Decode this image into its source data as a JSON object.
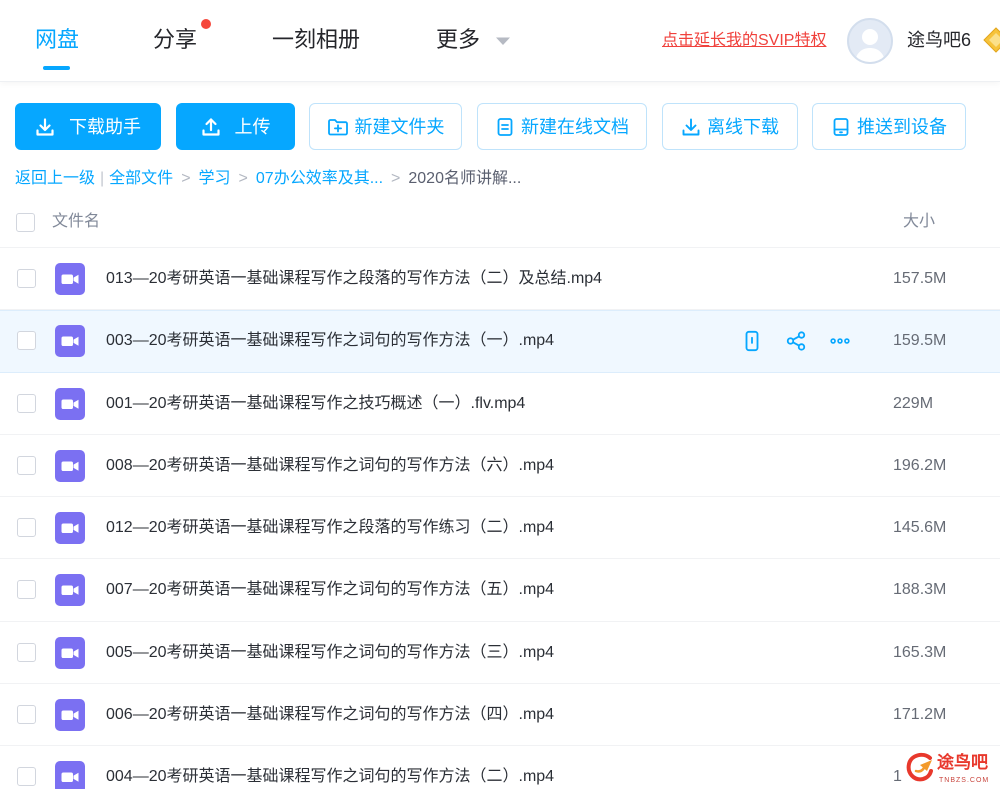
{
  "nav": {
    "tabs": [
      {
        "label": "网盘",
        "active": true
      },
      {
        "label": "分享",
        "has_notification_dot": true
      },
      {
        "label": "一刻相册"
      },
      {
        "label": "更多",
        "icon": "chevron-down-icon"
      }
    ],
    "promo_link": "点击延长我的SVIP特权",
    "user": {
      "name": "途鸟吧6",
      "avatar_icon": "avatar-icon",
      "badge_icon": "svip-badge-icon"
    }
  },
  "toolbar": {
    "buttons": [
      {
        "label": "下载助手",
        "icon": "download-icon",
        "variant": "primary"
      },
      {
        "label": "上传",
        "icon": "upload-icon",
        "variant": "primary"
      },
      {
        "label": "新建文件夹",
        "icon": "folder-plus-icon",
        "variant": "outline"
      },
      {
        "label": "新建在线文档",
        "icon": "document-icon",
        "variant": "outline"
      },
      {
        "label": "离线下载",
        "icon": "offline-download-icon",
        "variant": "outline"
      },
      {
        "label": "推送到设备",
        "icon": "device-icon",
        "variant": "outline"
      }
    ]
  },
  "breadcrumb": {
    "back": "返回上一级",
    "divider": "|",
    "separator": ">",
    "path": [
      "全部文件",
      "学习",
      "07办公效率及其...",
      "2020名师讲解..."
    ]
  },
  "file_list": {
    "columns": {
      "name": "文件名",
      "size": "大小"
    },
    "file_icon": "video-file-icon",
    "row_actions": [
      "send-to-phone-icon",
      "share-icon",
      "more-icon"
    ],
    "rows": [
      {
        "name": "013—20考研英语一基础课程写作之段落的写作方法（二）及总结.mp4",
        "size": "157.5M"
      },
      {
        "name": "003—20考研英语一基础课程写作之词句的写作方法（一）.mp4",
        "size": "159.5M",
        "hovered": true
      },
      {
        "name": "001—20考研英语一基础课程写作之技巧概述（一）.flv.mp4",
        "size": "229M"
      },
      {
        "name": "008—20考研英语一基础课程写作之词句的写作方法（六）.mp4",
        "size": "196.2M"
      },
      {
        "name": "012—20考研英语一基础课程写作之段落的写作练习（二）.mp4",
        "size": "145.6M"
      },
      {
        "name": "007—20考研英语一基础课程写作之词句的写作方法（五）.mp4",
        "size": "188.3M"
      },
      {
        "name": "005—20考研英语一基础课程写作之词句的写作方法（三）.mp4",
        "size": "165.3M"
      },
      {
        "name": "006—20考研英语一基础课程写作之词句的写作方法（四）.mp4",
        "size": "171.2M"
      },
      {
        "name": "004—20考研英语一基础课程写作之词句的写作方法（二）.mp4",
        "size": "1"
      }
    ]
  },
  "watermark": {
    "text": "途鸟吧",
    "subtext": "TNBZS.COM"
  },
  "colors": {
    "accent": "#06a7ff",
    "promo": "#f0413c",
    "file_icon": "#7b70f2",
    "hover_row": "#f0f8ff"
  }
}
